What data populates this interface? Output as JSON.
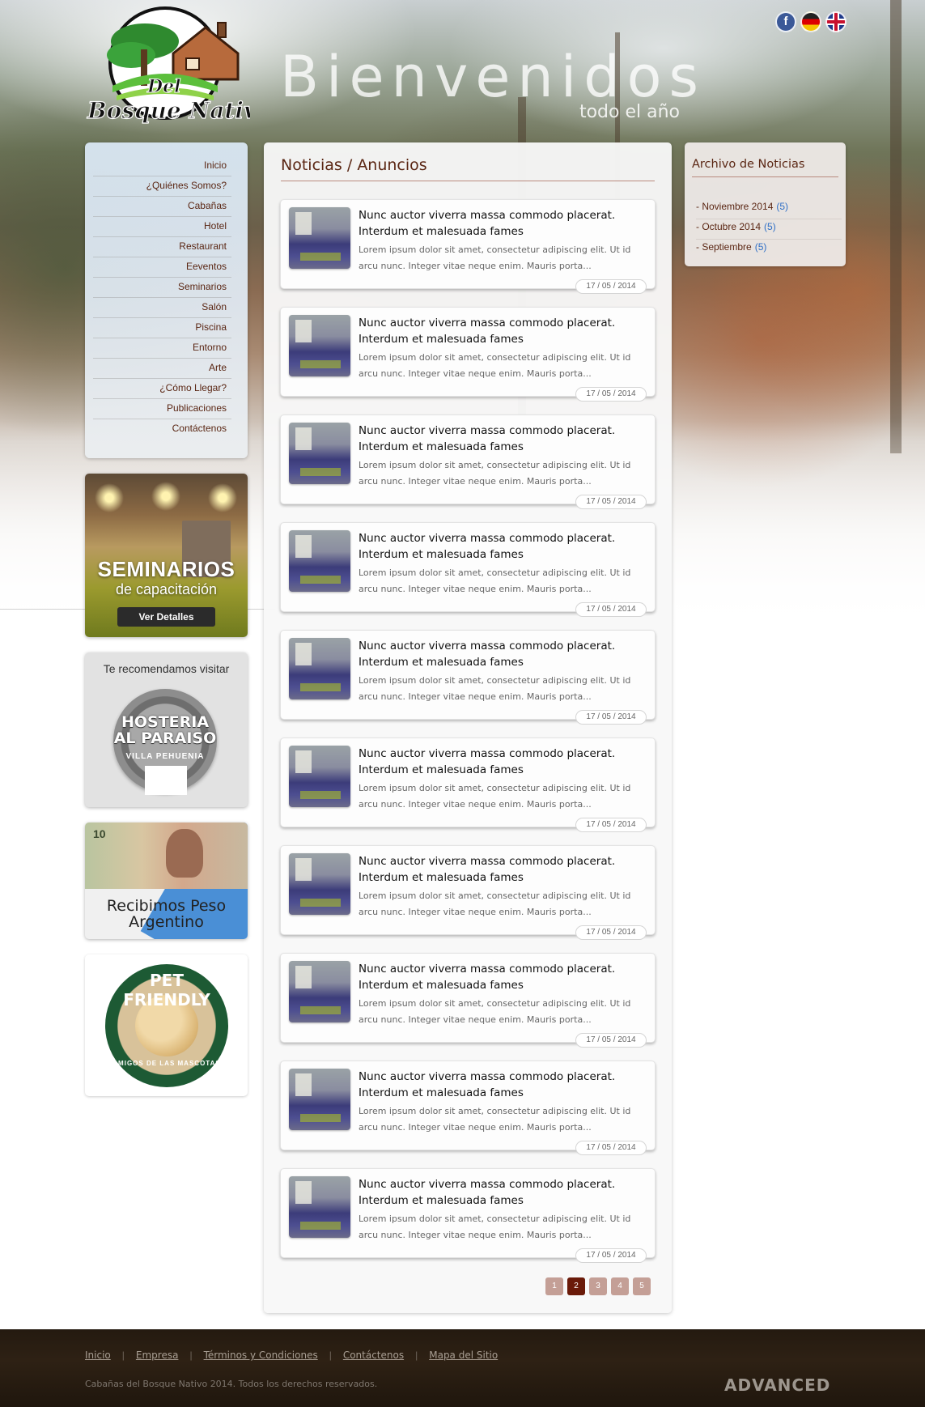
{
  "header": {
    "logo_text_line1": "Del",
    "logo_text_line2": "Bosque Nativo",
    "welcome_title": "Bienvenidos",
    "welcome_subtitle": "todo el año",
    "social": {
      "facebook_glyph": "f"
    }
  },
  "nav": {
    "items": [
      "Inicio",
      "¿Quiénes Somos?",
      "Cabañas",
      "Hotel",
      "Restaurant",
      "Eeventos",
      "Seminarios",
      "Salón",
      "Piscina",
      "Entorno",
      "Arte",
      "¿Cómo Llegar?",
      "Publicaciones",
      "Contáctenos"
    ]
  },
  "promos": {
    "seminar": {
      "title": "SEMINARIOS",
      "subtitle": "de capacitación",
      "button": "Ver Detalles"
    },
    "visit": {
      "label": "Te recomendamos visitar",
      "badge_line1": "HOSTERIA",
      "badge_line2": "AL PARAISO",
      "badge_sub": "VILLA PEHUENIA"
    },
    "pesos": {
      "note_value": "10",
      "caption_line1": "Recibimos Peso",
      "caption_line2": "Argentino"
    },
    "pet": {
      "ring_text": "PET FRIENDLY",
      "ring_sub": "AMIGOS DE LAS MASCOTAS"
    }
  },
  "main": {
    "title": "Noticias / Anuncios",
    "news": [
      {
        "title": "Nunc auctor viverra massa commodo placerat. Interdum et malesuada fames",
        "body": "Lorem ipsum dolor sit amet, consectetur adipiscing elit. Ut id arcu nunc. Integer vitae neque enim. Mauris porta...",
        "date": "17 / 05 / 2014"
      },
      {
        "title": "Nunc auctor viverra massa commodo placerat. Interdum et malesuada fames",
        "body": "Lorem ipsum dolor sit amet, consectetur adipiscing elit. Ut id arcu nunc. Integer vitae neque enim. Mauris porta...",
        "date": "17 / 05 / 2014"
      },
      {
        "title": "Nunc auctor viverra massa commodo placerat. Interdum et malesuada fames",
        "body": "Lorem ipsum dolor sit amet, consectetur adipiscing elit. Ut id arcu nunc. Integer vitae neque enim. Mauris porta...",
        "date": "17 / 05 / 2014"
      },
      {
        "title": "Nunc auctor viverra massa commodo placerat. Interdum et malesuada fames",
        "body": "Lorem ipsum dolor sit amet, consectetur adipiscing elit. Ut id arcu nunc. Integer vitae neque enim. Mauris porta...",
        "date": "17 / 05 / 2014"
      },
      {
        "title": "Nunc auctor viverra massa commodo placerat. Interdum et malesuada fames",
        "body": "Lorem ipsum dolor sit amet, consectetur adipiscing elit. Ut id arcu nunc. Integer vitae neque enim. Mauris porta...",
        "date": "17 / 05 / 2014"
      },
      {
        "title": "Nunc auctor viverra massa commodo placerat. Interdum et malesuada fames",
        "body": "Lorem ipsum dolor sit amet, consectetur adipiscing elit. Ut id arcu nunc. Integer vitae neque enim. Mauris porta...",
        "date": "17 / 05 / 2014"
      },
      {
        "title": "Nunc auctor viverra massa commodo placerat. Interdum et malesuada fames",
        "body": "Lorem ipsum dolor sit amet, consectetur adipiscing elit. Ut id arcu nunc. Integer vitae neque enim. Mauris porta...",
        "date": "17 / 05 / 2014"
      },
      {
        "title": "Nunc auctor viverra massa commodo placerat. Interdum et malesuada fames",
        "body": "Lorem ipsum dolor sit amet, consectetur adipiscing elit. Ut id arcu nunc. Integer vitae neque enim. Mauris porta...",
        "date": "17 / 05 / 2014"
      },
      {
        "title": "Nunc auctor viverra massa commodo placerat. Interdum et malesuada fames",
        "body": "Lorem ipsum dolor sit amet, consectetur adipiscing elit. Ut id arcu nunc. Integer vitae neque enim. Mauris porta...",
        "date": "17 / 05 / 2014"
      },
      {
        "title": "Nunc auctor viverra massa commodo placerat. Interdum et malesuada fames",
        "body": "Lorem ipsum dolor sit amet, consectetur adipiscing elit. Ut id arcu nunc. Integer vitae neque enim. Mauris porta...",
        "date": "17 / 05 / 2014"
      }
    ],
    "pagination": {
      "pages": [
        "1",
        "2",
        "3",
        "4",
        "5"
      ],
      "current": "2"
    }
  },
  "archive": {
    "title": "Archivo de Noticias",
    "items": [
      {
        "label": "- Noviembre 2014",
        "count": "(5)"
      },
      {
        "label": "- Octubre 2014",
        "count": "(5)"
      },
      {
        "label": "- Septiembre",
        "count": "(5)"
      }
    ]
  },
  "footer": {
    "links": [
      "Inicio",
      "Empresa",
      "Términos y Condiciones",
      "Contáctenos",
      "Mapa del Sitio"
    ],
    "copyright": "Cabañas del Bosque Nativo 2014. Todos los derechos reservados.",
    "brand": "ADVANCED"
  },
  "colors": {
    "accent": "#5a2613",
    "active_page": "#6a1a09",
    "page_button": "#c49f96",
    "archive_count": "#2f6fc6"
  }
}
